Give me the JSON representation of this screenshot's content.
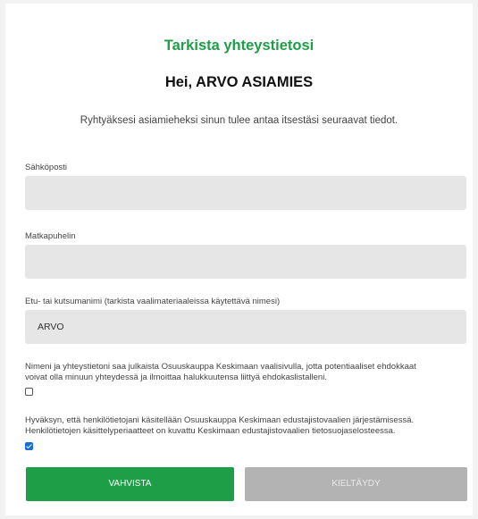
{
  "header": {
    "title": "Tarkista yhteystietosi",
    "greeting": "Hei, ARVO ASIAMIES",
    "intro": "Ryhtyäksesi asiamieheksi sinun tulee antaa itsestäsi seuraavat tiedot."
  },
  "form": {
    "email": {
      "label": "Sähköposti",
      "value": ""
    },
    "phone": {
      "label": "Matkapuhelin",
      "value": ""
    },
    "nickname": {
      "label": "Etu- tai kutsumanimi (tarkista vaalimateriaaleissa käytettävä nimesi)",
      "value": "ARVO"
    },
    "publish_consent": {
      "line1": "Nimeni ja yhteystietoni saa julkaista Osuuskauppa Keskimaan vaalisivulla, jotta potentiaaliset ehdokkaat",
      "line2": "voivat olla minuun yhteydessä ja ilmoittaa halukkuutensa liittyä ehdokaslistalleni.",
      "checked": false
    },
    "privacy_consent": {
      "line1": "Hyväksyn, että henkilötietojani käsitellään Osuuskauppa Keskimaan edustajistovaalien järjestämisessä.",
      "line2": "Henkilötietojen käsittelyperiaatteet on kuvattu Keskimaan edustajistovaalien tietosuojaselosteessa.",
      "checked": true
    }
  },
  "actions": {
    "confirm_label": "VAHVISTA",
    "decline_label": "KIELTÄYDY"
  },
  "colors": {
    "accent": "#1e9e47",
    "field_bg": "#e6e6e6",
    "disabled_button": "#b3b3b3",
    "checkbox_checked": "#1a6ed8"
  }
}
